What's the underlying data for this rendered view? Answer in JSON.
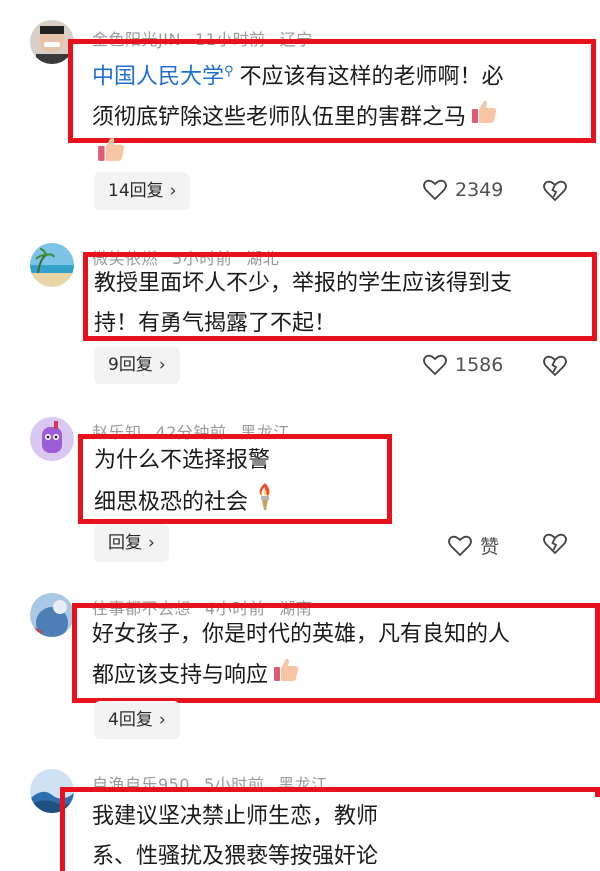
{
  "comments": [
    {
      "user": "金色阳光JIN",
      "time": "11小时前",
      "location": "辽宁",
      "link_text": "中国人民大学",
      "line1": "不应该有这样的老师啊！必",
      "line2": "须彻底铲除这些老师队伍里的害群之马",
      "reply_label": "14回复",
      "likes": "2349"
    },
    {
      "user": "微笑依燃",
      "time": "5小时前",
      "location": "湖北",
      "line1": "教授里面坏人不少，举报的学生应该得到支",
      "line2": "持！有勇气揭露了不起！",
      "reply_label": "9回复",
      "likes": "1586"
    },
    {
      "user": "赵乐知",
      "time": "42分钟前",
      "location": "黑龙江",
      "line1": "为什么不选择报警",
      "line2": "细思极恐的社会",
      "reply_label": "回复",
      "likes": "赞"
    },
    {
      "user": "往事都不去想",
      "time": "4小时前",
      "location": "湖南",
      "line1": "好女孩子，你是时代的英雄，凡有良知的人",
      "line2": "都应该支持与响应",
      "reply_label": "4回复"
    },
    {
      "user": "自渔自乐950",
      "time": "5小时前",
      "location": "黑龙江",
      "line1": "我建议坚决禁止师生恋，教师",
      "line2": "系、性骚扰及猥亵等按强奸论"
    }
  ],
  "colors": {
    "highlight_box": "#e8121c",
    "link": "#1f6fd1",
    "meta": "#9a9a9a"
  },
  "icons": [
    "thumbs-up-emoji",
    "heart-icon",
    "broken-heart-icon",
    "chevron-right-icon",
    "search-icon",
    "torch-emoji"
  ]
}
